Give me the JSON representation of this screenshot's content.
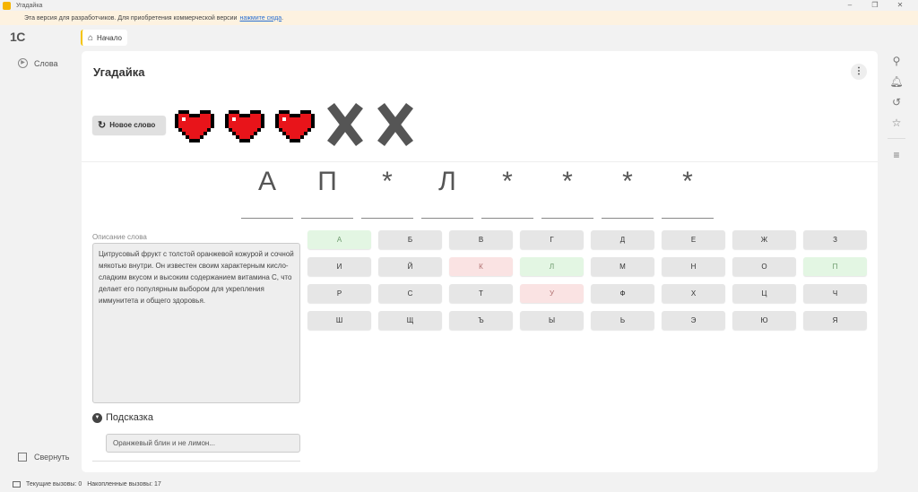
{
  "window": {
    "title": "Угадайка",
    "controls": [
      "–",
      "❐",
      "✕"
    ]
  },
  "banner": {
    "text": "Эта версия для разработчиков. Для приобретения коммерческой версии",
    "link": "нажмите сюда",
    "suffix": "."
  },
  "logo": "1С",
  "tabs": [
    {
      "label": "Начало"
    }
  ],
  "nav": {
    "items": [
      {
        "label": "Слова"
      }
    ],
    "collapse_label": "Свернуть"
  },
  "page": {
    "title": "Угадайка",
    "more_label": "⋮",
    "new_word_label": "Новое слово",
    "lives": {
      "remaining": 3,
      "lost": 2
    },
    "word_letters": [
      "А",
      "П",
      "*",
      "Л",
      "*",
      "*",
      "*",
      "*"
    ],
    "description_label": "Описание слова",
    "description": "Цитрусовый фрукт с толстой оранжевой кожурой и сочной мякотью внутри. Он известен своим характерным кисло-сладким вкусом и высоким содержанием витамина С, что делает его популярным выбором для укрепления иммунитета и общего здоровья.",
    "hint_label": "Подсказка",
    "hint_text": "Оранжевый блин и не лимон..."
  },
  "keyboard": {
    "rows": [
      [
        {
          "l": "А",
          "s": "ok"
        },
        {
          "l": "Б",
          "s": ""
        },
        {
          "l": "В",
          "s": ""
        },
        {
          "l": "Г",
          "s": ""
        },
        {
          "l": "Д",
          "s": ""
        },
        {
          "l": "Е",
          "s": ""
        },
        {
          "l": "Ж",
          "s": ""
        },
        {
          "l": "З",
          "s": ""
        }
      ],
      [
        {
          "l": "И",
          "s": ""
        },
        {
          "l": "Й",
          "s": ""
        },
        {
          "l": "К",
          "s": "bad"
        },
        {
          "l": "Л",
          "s": "ok"
        },
        {
          "l": "М",
          "s": ""
        },
        {
          "l": "Н",
          "s": ""
        },
        {
          "l": "О",
          "s": ""
        },
        {
          "l": "П",
          "s": "ok"
        }
      ],
      [
        {
          "l": "Р",
          "s": ""
        },
        {
          "l": "С",
          "s": ""
        },
        {
          "l": "Т",
          "s": ""
        },
        {
          "l": "У",
          "s": "bad"
        },
        {
          "l": "Ф",
          "s": ""
        },
        {
          "l": "Х",
          "s": ""
        },
        {
          "l": "Ц",
          "s": ""
        },
        {
          "l": "Ч",
          "s": ""
        }
      ],
      [
        {
          "l": "Ш",
          "s": ""
        },
        {
          "l": "Щ",
          "s": ""
        },
        {
          "l": "Ъ",
          "s": ""
        },
        {
          "l": "Ы",
          "s": ""
        },
        {
          "l": "Ь",
          "s": ""
        },
        {
          "l": "Э",
          "s": ""
        },
        {
          "l": "Ю",
          "s": ""
        },
        {
          "l": "Я",
          "s": ""
        }
      ]
    ]
  },
  "right_tools": [
    "search-icon",
    "bell-icon",
    "history-icon",
    "star-icon",
    "filter-icon"
  ],
  "status": {
    "current_calls": "Текущие вызовы: 0",
    "accumulated_calls": "Накопленные вызовы: 17"
  },
  "colors": {
    "heart": "#e8141a",
    "lost": "#555555",
    "key_ok": "#e3f6e3",
    "key_bad": "#fae3e3",
    "banner_bg": "#fdf2e0"
  }
}
